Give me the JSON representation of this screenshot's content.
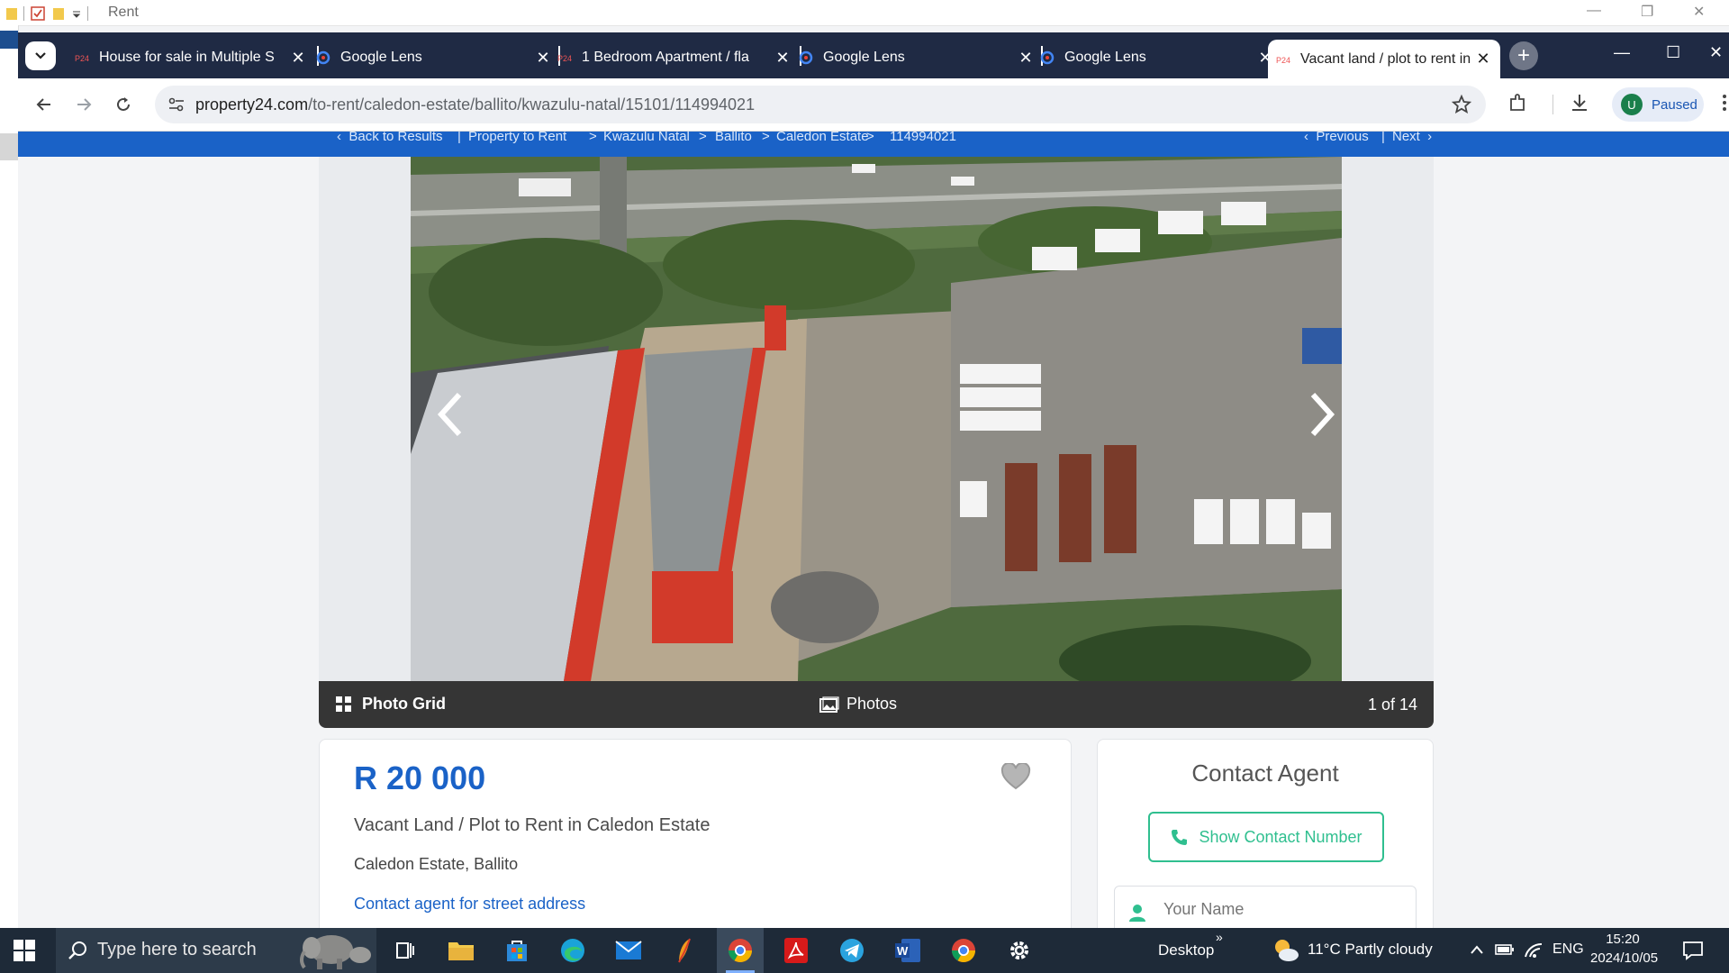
{
  "outer_window": {
    "title": "Rent"
  },
  "browser": {
    "tabs": [
      {
        "title": "House for sale in Multiple S",
        "favicon": "property24-favicon"
      },
      {
        "title": "Google Lens",
        "favicon": "google-lens-favicon"
      },
      {
        "title": "1 Bedroom Apartment / fla",
        "favicon": "property24-favicon"
      },
      {
        "title": "Google Lens",
        "favicon": "google-lens-favicon"
      },
      {
        "title": "Google Lens",
        "favicon": "google-lens-favicon"
      },
      {
        "title": "Vacant land / plot to rent in",
        "favicon": "property24-favicon",
        "active": true
      }
    ],
    "url_domain": "property24.com",
    "url_path": "/to-rent/caledon-estate/ballito/kwazulu-natal/15101/114994021",
    "profile": {
      "initial": "U",
      "label": "Paused"
    }
  },
  "breadcrumb": {
    "back": "Back to Results",
    "items": [
      "Property to Rent",
      "Kwazulu Natal",
      "Ballito",
      "Caledon Estate",
      "114994021"
    ],
    "separator": ">",
    "previous": "Previous",
    "next": "Next"
  },
  "gallery": {
    "photo_grid_label": "Photo Grid",
    "photos_label": "Photos",
    "counter": "1 of 14"
  },
  "listing": {
    "price": "R 20 000",
    "title": "Vacant Land / Plot to Rent in Caledon Estate",
    "location": "Caledon Estate, Ballito",
    "address_link": "Contact agent for street address"
  },
  "contact": {
    "heading": "Contact Agent",
    "show_number": "Show Contact Number",
    "name_placeholder": "Your Name"
  },
  "taskbar": {
    "search_placeholder": "Type here to search",
    "desktop_label": "Desktop",
    "weather": "11°C  Partly cloudy",
    "language": "ENG",
    "time": "15:20",
    "date": "2024/10/05"
  },
  "colors": {
    "brand_blue": "#1a62c7",
    "tabbar_bg": "#1f2a44",
    "accent_green": "#2fbf8f",
    "taskbar_bg": "#1e2a38"
  }
}
